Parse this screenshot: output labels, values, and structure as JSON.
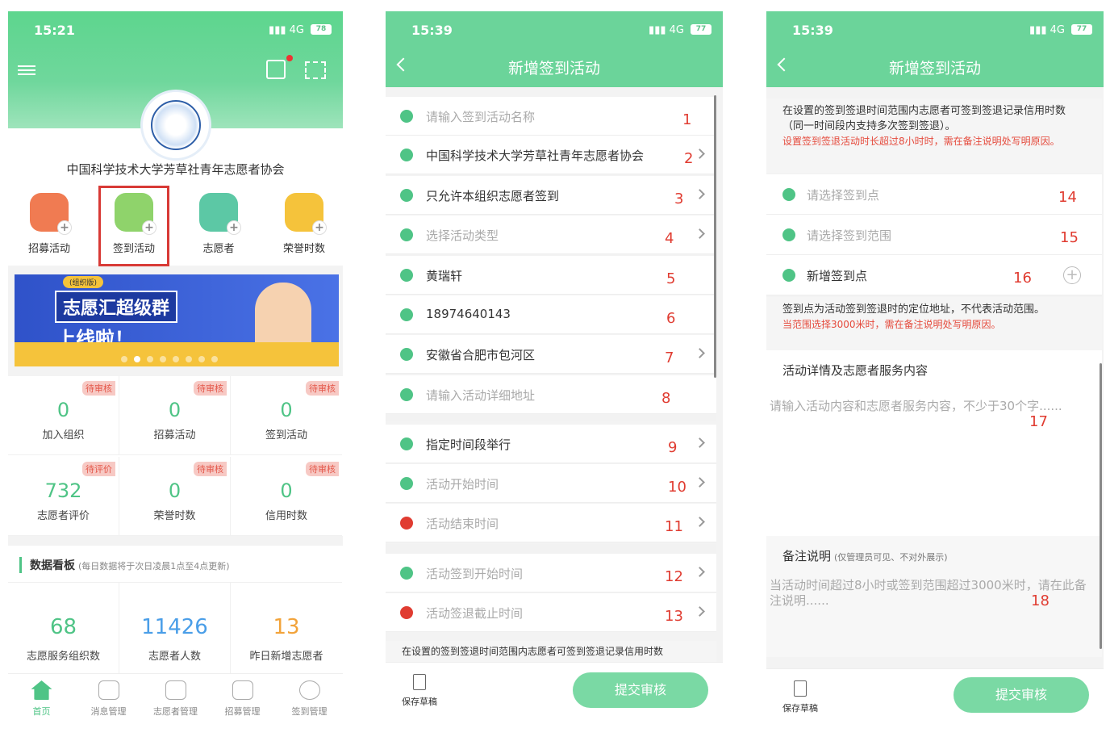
{
  "screen1": {
    "time": "15:21",
    "network": "4G",
    "battery": "78",
    "org_name": "中国科学技术大学芳草社青年志愿者协会",
    "quick_actions": [
      "招募活动",
      "签到活动",
      "志愿者",
      "荣誉时数"
    ],
    "banner": {
      "tag": "(组织版)",
      "line1": "志愿汇超级群",
      "line2": "上线啦！"
    },
    "stats": [
      {
        "badge": "待审核",
        "value": "0",
        "label": "加入组织"
      },
      {
        "badge": "待审核",
        "value": "0",
        "label": "招募活动"
      },
      {
        "badge": "待审核",
        "value": "0",
        "label": "签到活动"
      },
      {
        "badge": "待评价",
        "value": "732",
        "label": "志愿者评价"
      },
      {
        "badge": "待审核",
        "value": "0",
        "label": "荣誉时数"
      },
      {
        "badge": "待审核",
        "value": "0",
        "label": "信用时数"
      }
    ],
    "dashboard": {
      "title": "数据看板",
      "note": "(每日数据将于次日凌晨1点至4点更新)",
      "cells": [
        {
          "value": "68",
          "label": "志愿服务组织数",
          "color": "#4fc486"
        },
        {
          "value": "11426",
          "label": "志愿者人数",
          "color": "#4a9ee8"
        },
        {
          "value": "13",
          "label": "昨日新增志愿者",
          "color": "#f2a33a"
        }
      ]
    },
    "tabs": [
      "首页",
      "消息管理",
      "志愿者管理",
      "招募管理",
      "签到管理"
    ]
  },
  "screen2": {
    "time": "15:39",
    "network": "4G",
    "battery": "77",
    "title": "新增签到活动",
    "rows": [
      {
        "text": "请输入签到活动名称",
        "num": "1",
        "placeholder": true,
        "chevron": false,
        "color": "#4fc486"
      },
      {
        "text": "中国科学技术大学芳草社青年志愿者协会",
        "num": "2",
        "placeholder": false,
        "chevron": true,
        "color": "#4fc486"
      },
      {
        "text": "只允许本组织志愿者签到",
        "num": "3",
        "placeholder": false,
        "chevron": true,
        "color": "#4fc486"
      },
      {
        "text": "选择活动类型",
        "num": "4",
        "placeholder": true,
        "chevron": true,
        "color": "#4fc486"
      },
      {
        "text": "黄瑞轩",
        "num": "5",
        "placeholder": false,
        "chevron": false,
        "color": "#4fc486"
      },
      {
        "text": "18974640143",
        "num": "6",
        "placeholder": false,
        "chevron": false,
        "color": "#4fc486"
      },
      {
        "text": "安徽省合肥市包河区",
        "num": "7",
        "placeholder": false,
        "chevron": true,
        "color": "#4fc486"
      },
      {
        "text": "请输入活动详细地址",
        "num": "8",
        "placeholder": true,
        "chevron": false,
        "color": "#4fc486"
      },
      {
        "text": "指定时间段举行",
        "num": "9",
        "placeholder": false,
        "chevron": true,
        "color": "#4fc486"
      },
      {
        "text": "活动开始时间",
        "num": "10",
        "placeholder": true,
        "chevron": true,
        "color": "#4fc486"
      },
      {
        "text": "活动结束时间",
        "num": "11",
        "placeholder": true,
        "chevron": true,
        "color": "#e03c31"
      },
      {
        "text": "活动签到开始时间",
        "num": "12",
        "placeholder": true,
        "chevron": true,
        "color": "#4fc486"
      },
      {
        "text": "活动签退截止时间",
        "num": "13",
        "placeholder": true,
        "chevron": true,
        "color": "#e03c31"
      }
    ],
    "note": "在设置的签到签退时间范围内志愿者可签到签退记录信用时数",
    "save_label": "保存草稿",
    "submit_label": "提交审核"
  },
  "screen3": {
    "time": "15:39",
    "network": "4G",
    "battery": "77",
    "title": "新增签到活动",
    "tip1": "在设置的签到签退时间范围内志愿者可签到签退记录信用时数（同一时间段内支持多次签到签退）。",
    "tip1_red": "设置签到签退活动时长超过8小时时，需在备注说明处写明原因。",
    "rows": [
      {
        "text": "请选择签到点",
        "num": "14"
      },
      {
        "text": "请选择签到范围",
        "num": "15"
      },
      {
        "text": "新增签到点",
        "num": "16"
      }
    ],
    "tip2": "签到点为活动签到签退时的定位地址，不代表活动范围。",
    "tip2_red": "当范围选择3000米时，需在备注说明处写明原因。",
    "detail_title": "活动详情及志愿者服务内容",
    "detail_placeholder": "请输入活动内容和志愿者服务内容，不少于30个字......",
    "detail_num": "17",
    "remark_title": "备注说明",
    "remark_note": "(仅管理员可见、不对外展示)",
    "remark_placeholder": "当活动时间超过8小时或签到范围超过3000米时，请在此备注说明......",
    "remark_num": "18",
    "save_label": "保存草稿",
    "submit_label": "提交审核"
  }
}
